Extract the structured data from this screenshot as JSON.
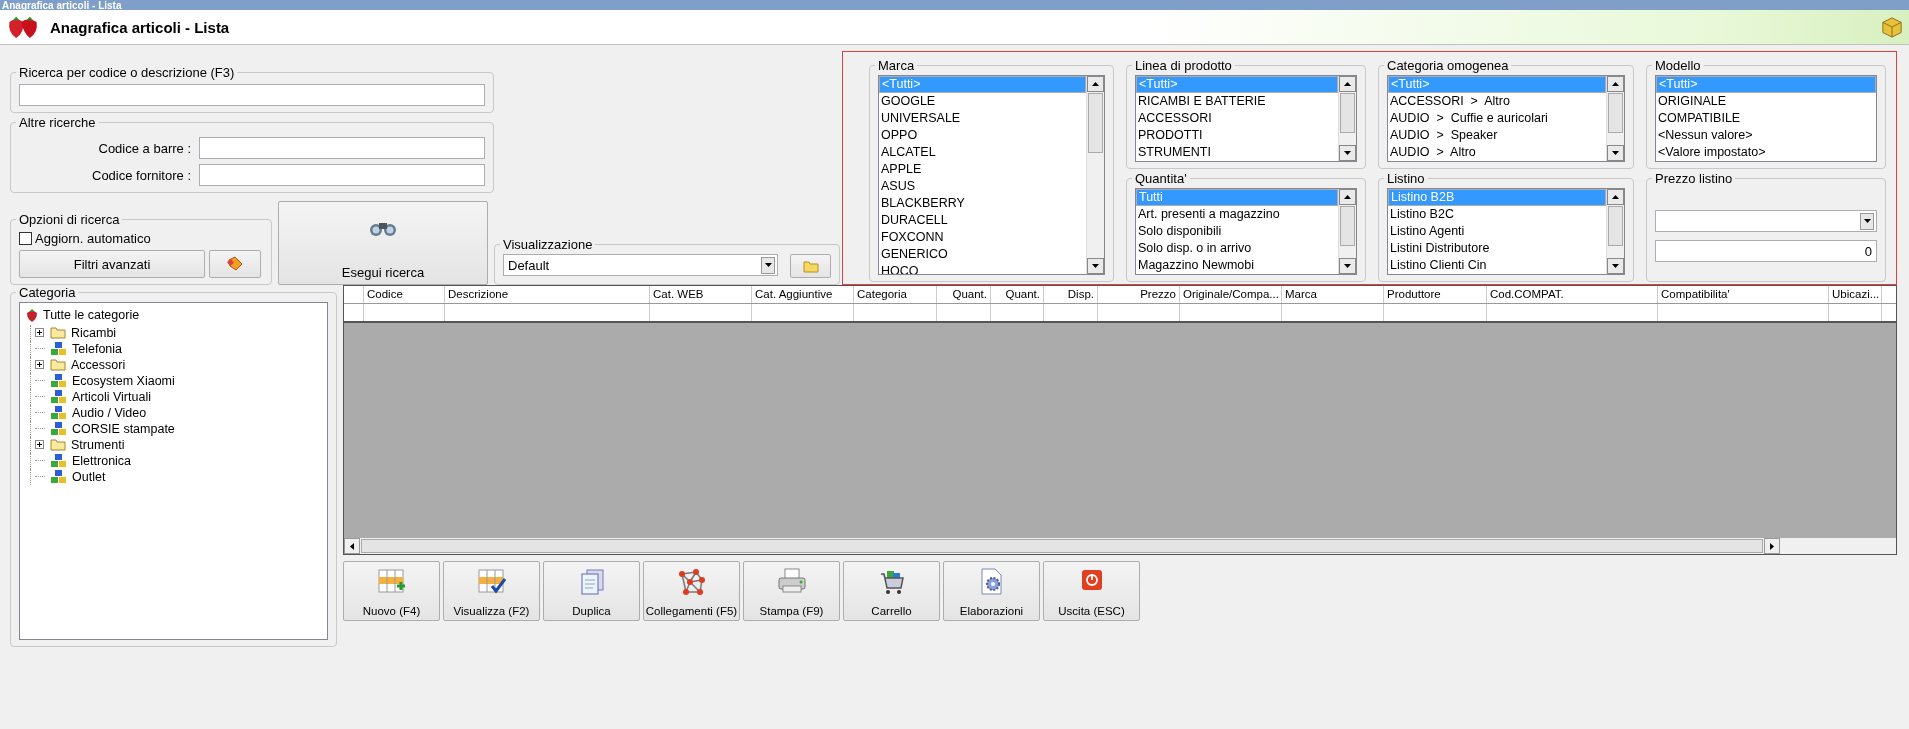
{
  "window": {
    "title": "Anagrafica articoli - Lista"
  },
  "header": {
    "title": "Anagrafica articoli  - Lista"
  },
  "search": {
    "title": "Ricerca per codice o descrizione (F3)"
  },
  "other_search": {
    "title": "Altre ricerche",
    "fields": [
      {
        "label": "Codice a barre :"
      },
      {
        "label": "Codice fornitore :"
      }
    ]
  },
  "options": {
    "title": "Opzioni di ricerca",
    "auto_update": {
      "label": "Aggiorn. automatico",
      "checked": false
    },
    "advanced_button": "Filtri avanzati"
  },
  "run_search_button": "Esegui ricerca",
  "view": {
    "title": "Visualizzazione",
    "value": "Default"
  },
  "filters": [
    {
      "title": "Marca",
      "items": [
        {
          "label": "<Tutti>",
          "selected": true
        },
        {
          "label": "GOOGLE",
          "selected": false
        },
        {
          "label": "UNIVERSALE",
          "selected": false
        },
        {
          "label": "OPPO",
          "selected": false
        },
        {
          "label": "ALCATEL",
          "selected": false
        },
        {
          "label": "APPLE",
          "selected": false
        },
        {
          "label": "ASUS",
          "selected": false
        },
        {
          "label": "BLACKBERRY",
          "selected": false
        },
        {
          "label": "DURACELL",
          "selected": false
        },
        {
          "label": "FOXCONN",
          "selected": false
        },
        {
          "label": "GENERICO",
          "selected": false
        },
        {
          "label": "HOCO",
          "selected": false
        }
      ]
    },
    {
      "title": "Linea di prodotto",
      "items": [
        {
          "label": "<Tutti>",
          "selected": true
        },
        {
          "label": "RICAMBI E BATTERIE",
          "selected": false
        },
        {
          "label": "ACCESSORI",
          "selected": false
        },
        {
          "label": "PRODOTTI",
          "selected": false
        },
        {
          "label": "STRUMENTI",
          "selected": false
        }
      ]
    },
    {
      "title": "Categoria omogenea",
      "items": [
        {
          "label": "<Tutti>",
          "selected": true
        },
        {
          "label": "ACCESSORI  >  Altro",
          "selected": false
        },
        {
          "label": "AUDIO  >  Cuffie e auricolari",
          "selected": false
        },
        {
          "label": "AUDIO  >  Speaker",
          "selected": false
        },
        {
          "label": "AUDIO  >  Altro",
          "selected": false
        }
      ]
    },
    {
      "title": "Modello",
      "items": [
        {
          "label": "<Tutti>",
          "selected": true
        },
        {
          "label": "ORIGINALE",
          "selected": false
        },
        {
          "label": "COMPATIBILE",
          "selected": false
        },
        {
          "label": "<Nessun valore>",
          "selected": false
        },
        {
          "label": "<Valore impostato>",
          "selected": false
        }
      ]
    },
    {
      "title": "Quantita'",
      "items": [
        {
          "label": "Tutti",
          "selected": true
        },
        {
          "label": "Art. presenti a magazzino",
          "selected": false
        },
        {
          "label": "Solo disponibili",
          "selected": false
        },
        {
          "label": "Solo disp. o in arrivo",
          "selected": false
        },
        {
          "label": "Magazzino Newmobi",
          "selected": false
        }
      ]
    },
    {
      "title": "Listino",
      "items": [
        {
          "label": "Listino B2B",
          "selected": true
        },
        {
          "label": "Listino B2C",
          "selected": false
        },
        {
          "label": "Listino Agenti",
          "selected": false
        },
        {
          "label": "Listini Distributore",
          "selected": false
        },
        {
          "label": "Listino Clienti Cin",
          "selected": false
        }
      ]
    }
  ],
  "price_list": {
    "title": "Prezzo listino",
    "value": "0"
  },
  "category_tree": {
    "title": "Categoria",
    "root": {
      "label": "Tutte le categorie",
      "children": [
        {
          "label": "Ricambi",
          "kind": "folder",
          "expanded": false
        },
        {
          "label": "Telefonia",
          "kind": "leaf"
        },
        {
          "label": "Accessori",
          "kind": "folder",
          "expanded": false
        },
        {
          "label": "Ecosystem Xiaomi",
          "kind": "leaf"
        },
        {
          "label": "Articoli Virtuali",
          "kind": "leaf"
        },
        {
          "label": "Audio / Video",
          "kind": "leaf"
        },
        {
          "label": "CORSIE stampate",
          "kind": "leaf"
        },
        {
          "label": "Strumenti",
          "kind": "folder",
          "expanded": false
        },
        {
          "label": "Elettronica",
          "kind": "leaf"
        },
        {
          "label": "Outlet",
          "kind": "leaf"
        }
      ]
    }
  },
  "table": {
    "columns": [
      {
        "label": "Codice",
        "kind": "text"
      },
      {
        "label": "Descrizione",
        "kind": "text"
      },
      {
        "label": "Cat. WEB",
        "kind": "text"
      },
      {
        "label": "Cat. Aggiuntive",
        "kind": "text"
      },
      {
        "label": "Categoria",
        "kind": "text"
      },
      {
        "label": "Quant.",
        "kind": "number"
      },
      {
        "label": "Quant.",
        "kind": "number"
      },
      {
        "label": "Disp.",
        "kind": "number"
      },
      {
        "label": "Prezzo",
        "kind": "number"
      },
      {
        "label": "Originale/Compa...",
        "kind": "text"
      },
      {
        "label": "Marca",
        "kind": "text"
      },
      {
        "label": "Produttore",
        "kind": "text"
      },
      {
        "label": "Cod.COMPAT.",
        "kind": "text"
      },
      {
        "label": "Compatibilita'",
        "kind": "text"
      },
      {
        "label": "Ubicazi...",
        "kind": "text"
      }
    ]
  },
  "toolbar": [
    {
      "label": "Nuovo (F4)",
      "kind": "new"
    },
    {
      "label": "Visualizza (F2)",
      "kind": "view"
    },
    {
      "label": "Duplica",
      "kind": "copy"
    },
    {
      "label": "Collegamenti (F5)",
      "kind": "links"
    },
    {
      "label": "Stampa (F9)",
      "kind": "print"
    },
    {
      "label": "Carrello",
      "kind": "cart"
    },
    {
      "label": "Elaborazioni",
      "kind": "process"
    },
    {
      "label": "Uscita (ESC)",
      "kind": "exit"
    }
  ]
}
